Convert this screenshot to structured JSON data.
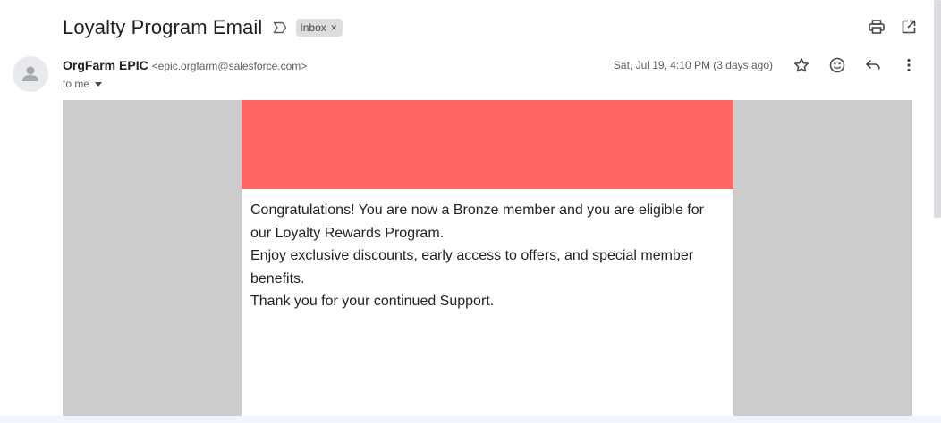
{
  "email": {
    "subject": "Loyalty Program Email",
    "label": "Inbox",
    "label_remove": "×",
    "sender_name": "OrgFarm EPIC",
    "sender_email": "<epic.orgfarm@salesforce.com>",
    "recipient": "to me",
    "date": "Sat, Jul 19, 4:10 PM (3 days ago)",
    "body_lines": [
      "Congratulations! You are now a Bronze member and you are eligible for our Loyalty Rewards Program.",
      "Enjoy exclusive discounts, early access to offers, and special member benefits.",
      "Thank you for your continued Support."
    ]
  },
  "icons": {
    "important": "important-marker-icon",
    "print": "print-icon",
    "open_new_window": "open-in-new-window-icon",
    "star": "star-icon",
    "emoji": "emoji-icon",
    "reply": "reply-icon",
    "more": "more-vert-icon",
    "avatar": "person-icon"
  },
  "colors": {
    "banner": "#ff6666",
    "canvas": "#cccccc",
    "label_chip": "#dddddd"
  }
}
